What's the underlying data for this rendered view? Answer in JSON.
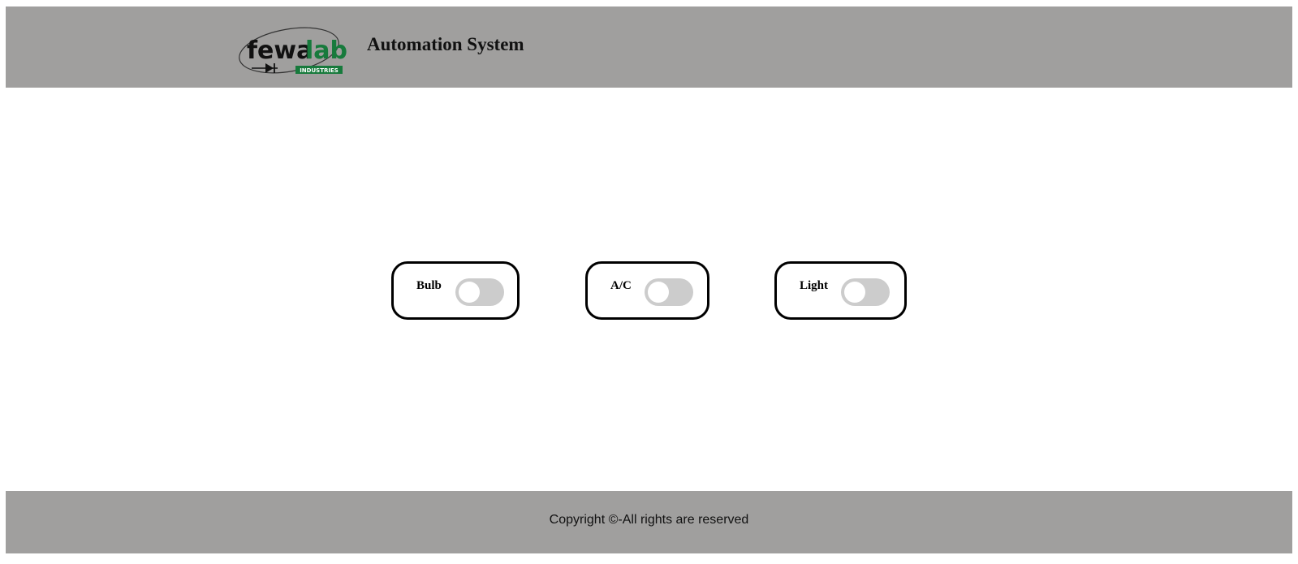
{
  "header": {
    "logo": {
      "text_dark": "fewa",
      "text_green": "lab",
      "tagline": "INDUSTRIES",
      "icon": "diode-orbit-icon"
    },
    "title": "Automation System"
  },
  "devices": [
    {
      "label": "Bulb",
      "enabled": false
    },
    {
      "label": "A/C",
      "enabled": false
    },
    {
      "label": "Light",
      "enabled": false
    }
  ],
  "footer": {
    "copyright": "Copyright ©-All rights are reserved"
  },
  "colors": {
    "bar_background": "#a09f9e",
    "logo_green": "#177a3c",
    "toggle_off": "#cccccc",
    "card_border": "#000000"
  }
}
